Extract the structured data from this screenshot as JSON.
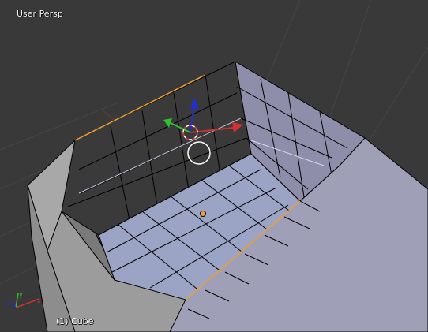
{
  "viewport": {
    "view_name": "User Persp",
    "object_info": "(1) Cube"
  },
  "colors": {
    "background": "#393939",
    "grid_line": "#464646",
    "mesh_wall_dark": "#383838",
    "mesh_wall_light": "#8a8aa6",
    "mesh_floor": "#9aa3c2",
    "mesh_outer": "#9a9a9a",
    "edge": "#000000",
    "selected_edge": "#f0a030",
    "axis_x": "#d03030",
    "axis_y": "#30c030",
    "axis_z": "#2030d0",
    "origin_dot": "#f0a040"
  },
  "icons": {
    "manipulator": "transform-manipulator-icon",
    "cursor": "3d-cursor-icon",
    "origin": "object-origin-icon",
    "axes": "view-axes-icon"
  }
}
